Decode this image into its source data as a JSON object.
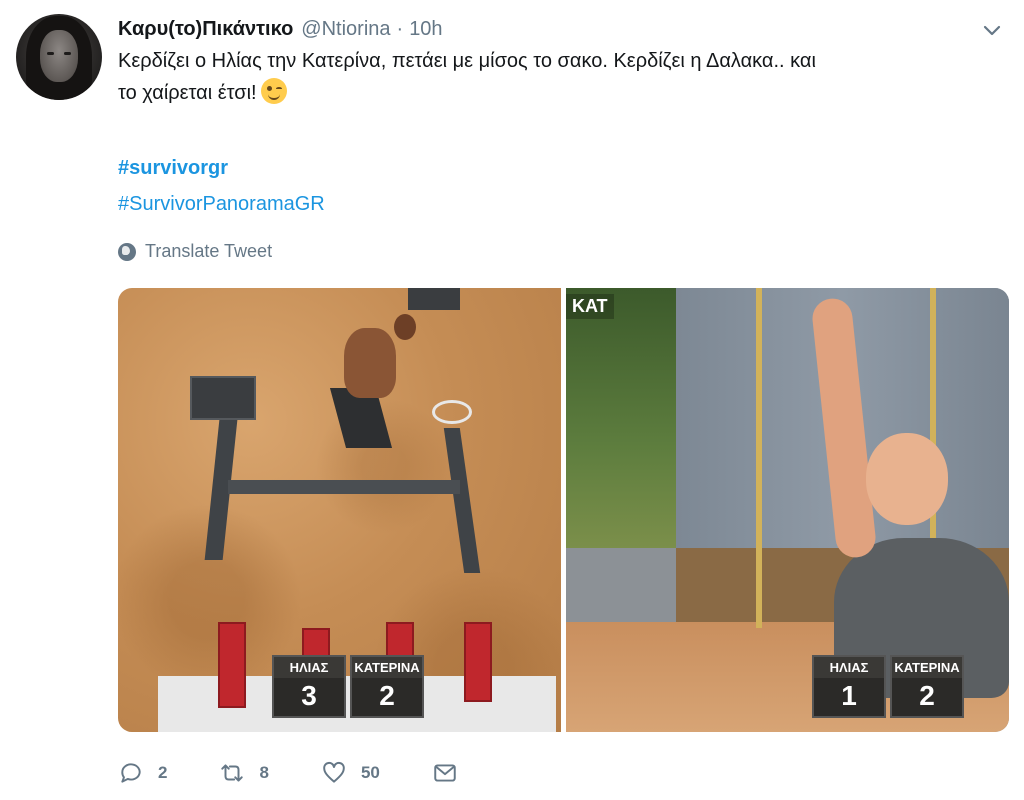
{
  "tweet": {
    "name": "Καρυ(το)Πικάντικο",
    "handle": "@Ntiorina",
    "separator": "·",
    "time": "10h",
    "text_line1": "Κερδίζει ο Ηλίας την Κατερίνα, πετάει με μίσος το σακο. Κερδίζει η Δαλακα.. και",
    "text_line2": "το χαίρεται έτσι!",
    "hashtags": [
      "#survivorgr",
      "#SurvivorPanoramaGR"
    ],
    "translate_label": "Translate Tweet"
  },
  "media": {
    "left_scoreboard": [
      {
        "name": "ΗΛΙΑΣ",
        "score": "3"
      },
      {
        "name": "ΚΑΤΕΡΙΝΑ",
        "score": "2"
      }
    ],
    "right_scoreboard": [
      {
        "name": "ΗΛΙΑΣ",
        "score": "1"
      },
      {
        "name": "ΚΑΤΕΡΙΝΑ",
        "score": "2"
      }
    ],
    "channel_logo_text": "ΚΑΤ"
  },
  "actions": {
    "replies": "2",
    "retweets": "8",
    "likes": "50"
  },
  "icons": [
    "caret-down-icon",
    "globe-icon",
    "reply-icon",
    "retweet-icon",
    "like-icon",
    "message-icon"
  ],
  "colors": {
    "link": "#1b95e0",
    "muted": "#657786",
    "text": "#14171a"
  }
}
